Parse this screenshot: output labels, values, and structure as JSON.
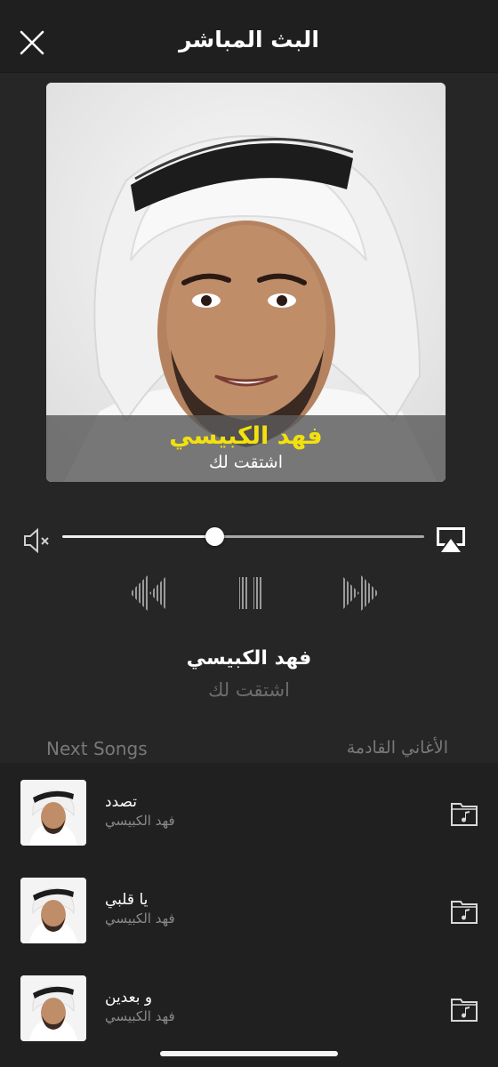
{
  "header": {
    "title": "البث المباشر",
    "close_icon": "close-icon"
  },
  "artwork": {
    "artist": "فهد الكبيسي",
    "song": "اشتقت لك",
    "artist_color": "#f2e10e"
  },
  "volume": {
    "level": 0.42,
    "mute_icon": "volume-mute-icon",
    "airplay_icon": "airplay-icon"
  },
  "controls": {
    "prev_icon": "rewind-icon",
    "pause_icon": "pause-icon",
    "next_icon": "fast-forward-icon"
  },
  "now_playing": {
    "artist": "فهد الكبيسي",
    "song": "اشتقت لك"
  },
  "next_songs": {
    "label_en": "Next Songs",
    "label_ar": "الأغاني القادمة",
    "items": [
      {
        "title": "تصدد",
        "artist": "فهد الكبيسي",
        "icon": "music-folder-icon"
      },
      {
        "title": "يا قلبي",
        "artist": "فهد الكبيسي",
        "icon": "music-folder-icon"
      },
      {
        "title": "و بعدين",
        "artist": "فهد الكبيسي",
        "icon": "music-folder-icon"
      }
    ]
  }
}
